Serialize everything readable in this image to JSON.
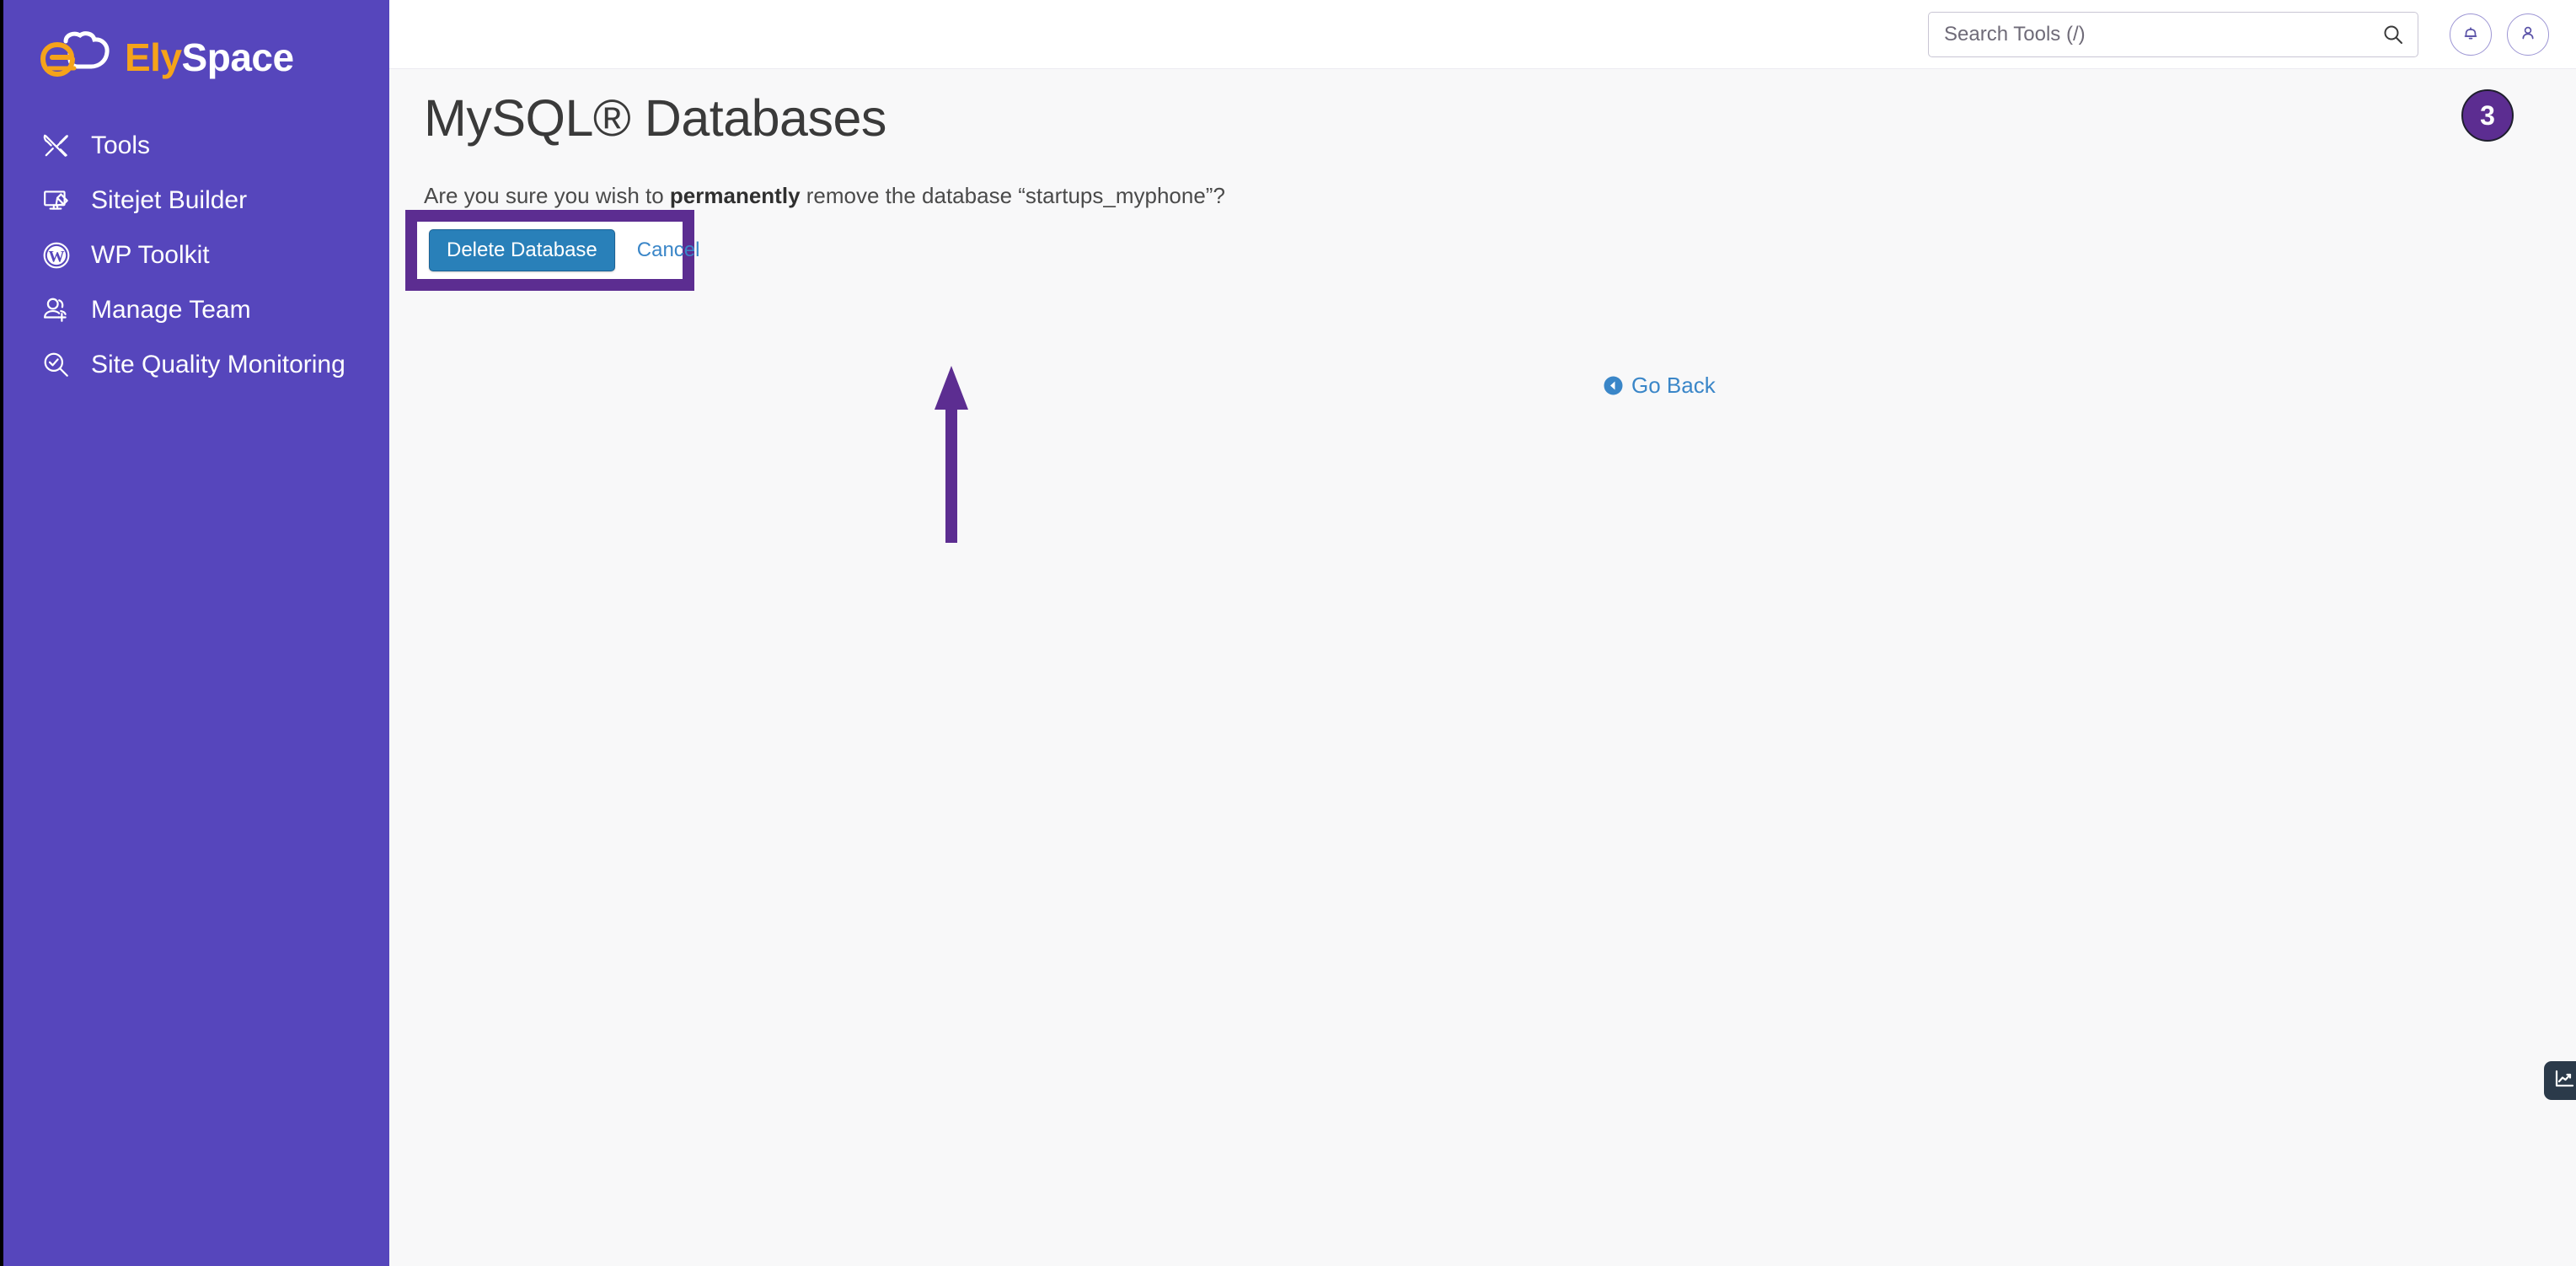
{
  "brand": {
    "logo_ely": "Ely",
    "logo_space": "Space",
    "logo_icon": "cloud-e-logo",
    "sidebar_color": "#5646bc",
    "accent_orange": "#f5a31a"
  },
  "sidebar": {
    "items": [
      {
        "label": "Tools",
        "icon": "tools-icon"
      },
      {
        "label": "Sitejet Builder",
        "icon": "monitor-pencil-icon"
      },
      {
        "label": "WP Toolkit",
        "icon": "wordpress-icon"
      },
      {
        "label": "Manage Team",
        "icon": "user-plus-icon"
      },
      {
        "label": "Site Quality Monitoring",
        "icon": "magnifier-check-icon"
      }
    ]
  },
  "header": {
    "search": {
      "placeholder": "Search Tools (/)",
      "value": "",
      "icon": "search-icon"
    },
    "notifications_icon": "bell-icon",
    "account_icon": "user-icon"
  },
  "main": {
    "page_title": "MySQL® Databases",
    "confirm": {
      "prefix": "Are you sure you wish to ",
      "emphasis": "permanently",
      "suffix": " remove the database “startups_myphone”?",
      "database_name": "startups_myphone"
    },
    "delete_button": "Delete Database",
    "cancel_link": "Cancel",
    "go_back": {
      "label": "Go Back",
      "icon": "arrow-circle-left-icon"
    }
  },
  "annotations": {
    "step_number": "3",
    "highlight_color": "#5c2d91",
    "arrow_icon": "up-arrow-annotation"
  },
  "floating": {
    "analytics_icon": "chart-analytics-icon"
  }
}
